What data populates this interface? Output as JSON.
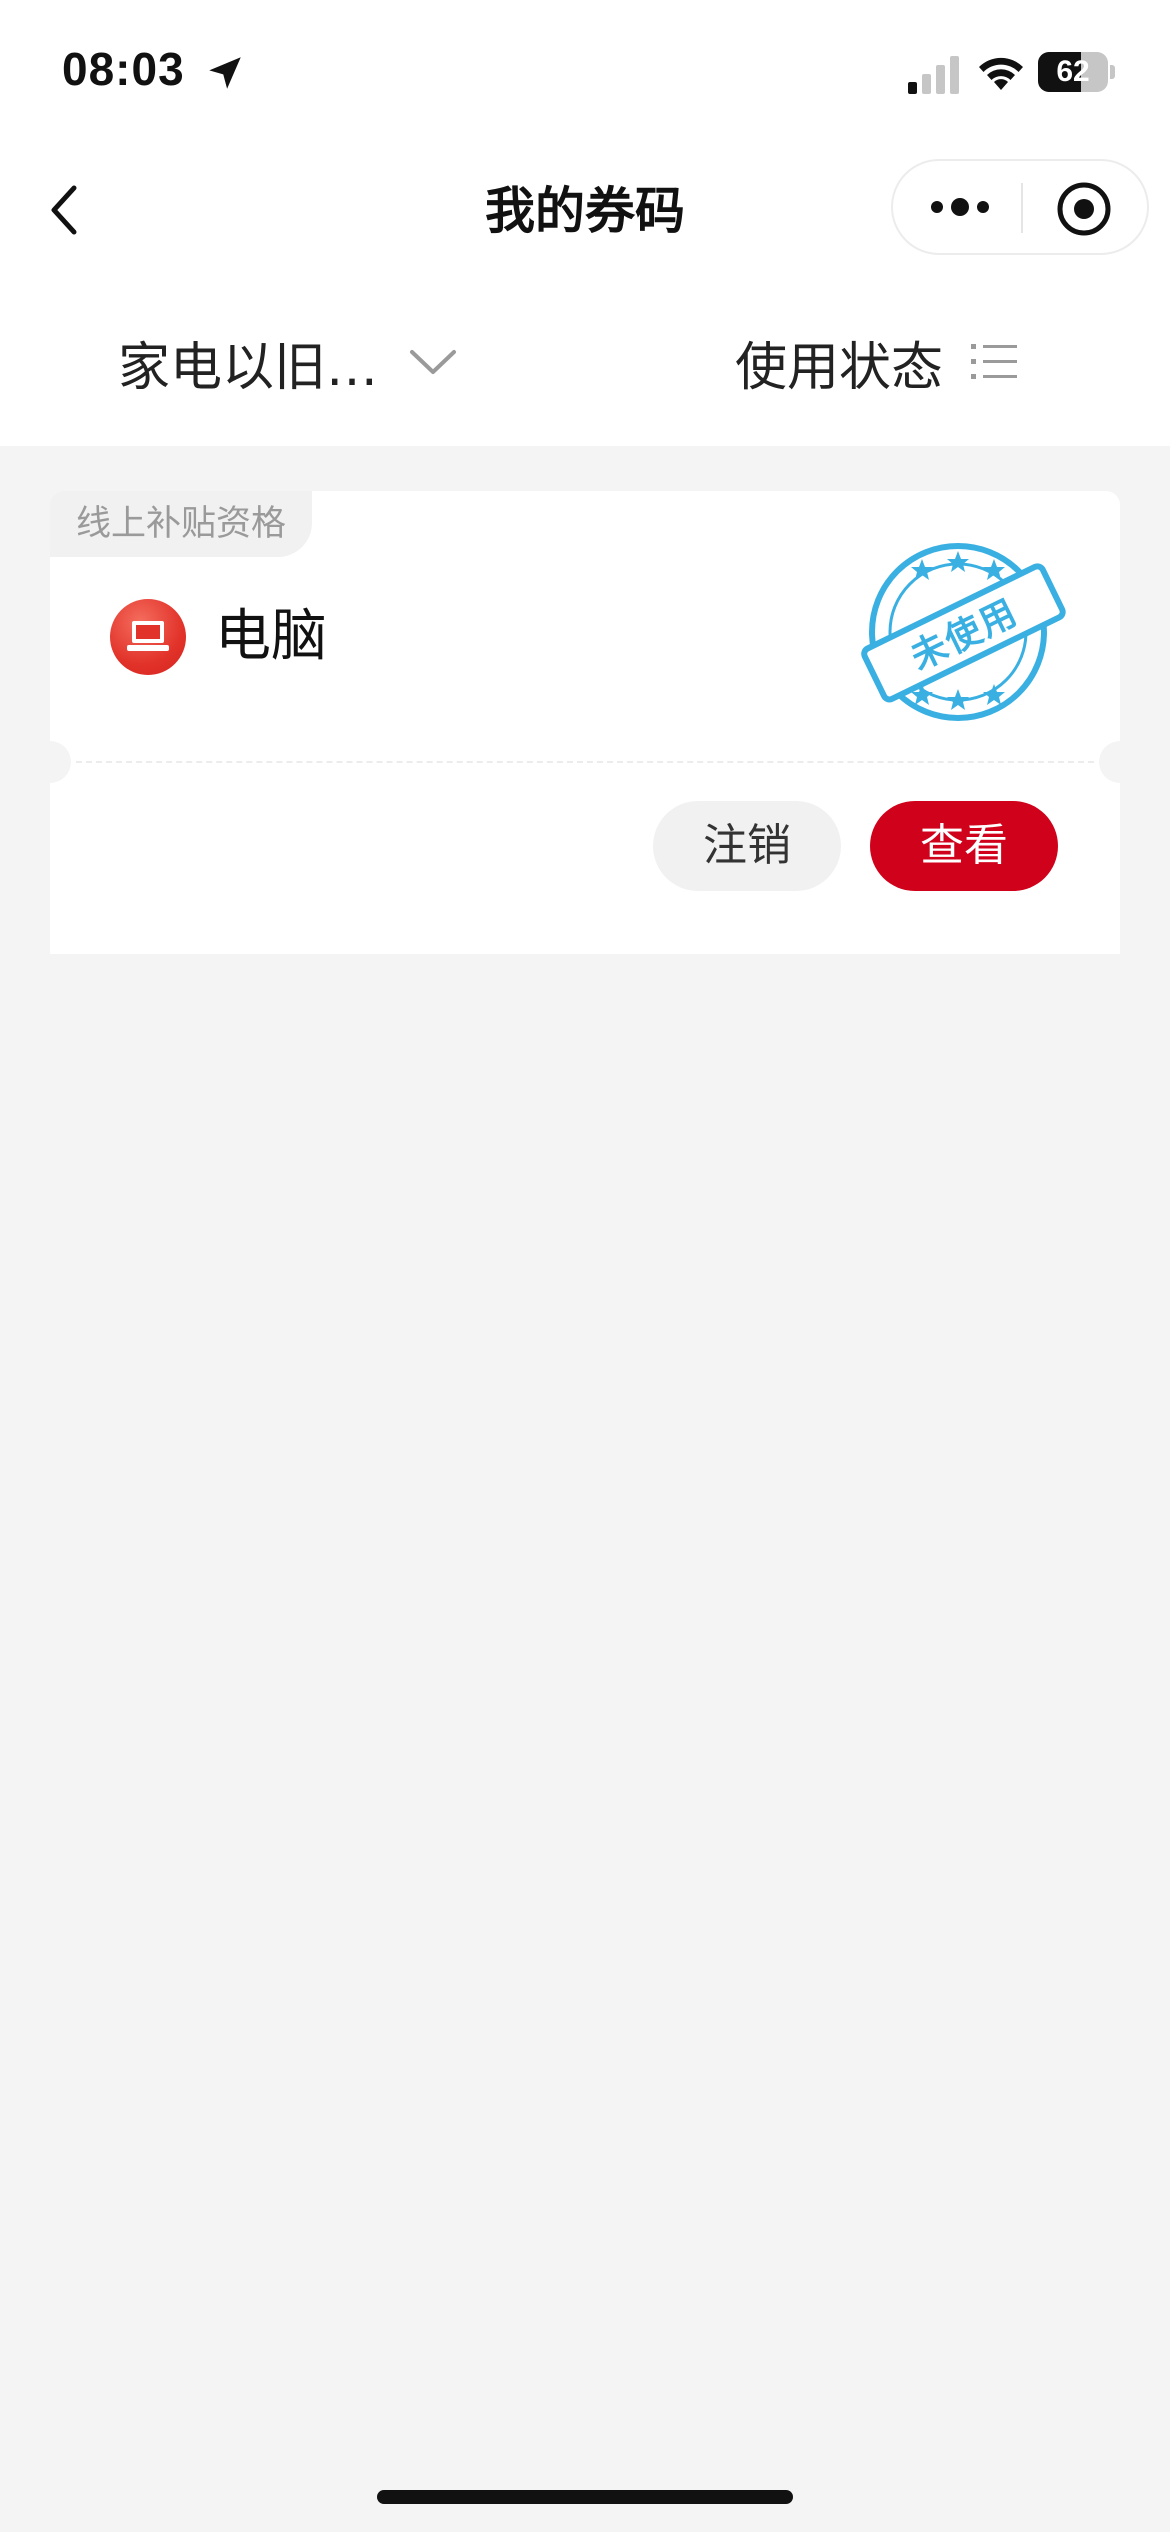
{
  "status_bar": {
    "time": "08:03",
    "battery_level": "62",
    "battery_fraction": 0.62,
    "icons": [
      "location-arrow-icon",
      "cellular-signal-icon",
      "wifi-icon",
      "battery-icon"
    ]
  },
  "nav": {
    "title": "我的券码",
    "icons": [
      "back-icon",
      "more-icon",
      "target-icon"
    ]
  },
  "filters": {
    "type_label": "家电以旧…",
    "status_label": "使用状态",
    "icons": [
      "chevron-down-icon",
      "list-icon"
    ]
  },
  "coupon": {
    "tag": "线上补贴资格",
    "item_name": "电脑",
    "item_icon": "laptop-icon",
    "stamp_text": "未使用",
    "cancel_label": "注销",
    "view_label": "查看",
    "accent_color": "#d0021b",
    "stamp_color": "#3ab0e2"
  }
}
